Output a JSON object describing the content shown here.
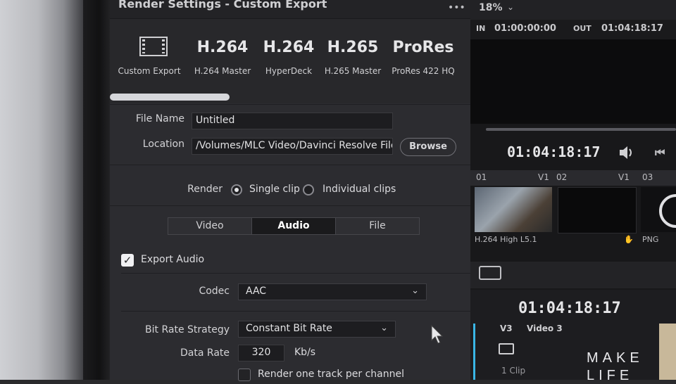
{
  "window": {
    "title": "Render Settings - Custom Export",
    "menu_glyph": "•••"
  },
  "presets": [
    {
      "big": "",
      "caption": "Custom Export",
      "icon": "film-icon"
    },
    {
      "big": "H.264",
      "caption": "H.264 Master"
    },
    {
      "big": "H.264",
      "caption": "HyperDeck"
    },
    {
      "big": "H.265",
      "caption": "H.265 Master"
    },
    {
      "big": "ProRes",
      "caption": "ProRes 422 HQ"
    }
  ],
  "file": {
    "name_label": "File Name",
    "name_value": "Untitled",
    "location_label": "Location",
    "location_value": "/Volumes/MLC Video/Davinci Resolve Files",
    "browse_label": "Browse"
  },
  "render": {
    "label": "Render",
    "single": "Single clip",
    "individual": "Individual clips",
    "selected": "single"
  },
  "tabs": [
    "Video",
    "Audio",
    "File"
  ],
  "active_tab": "Audio",
  "audio": {
    "export_label": "Export Audio",
    "export_checked": true,
    "codec_label": "Codec",
    "codec_value": "AAC",
    "bitrate_strategy_label": "Bit Rate Strategy",
    "bitrate_strategy_value": "Constant Bit Rate",
    "data_rate_label": "Data Rate",
    "data_rate_value": "320",
    "data_rate_unit": "Kb/s",
    "per_channel_label": "Render one track per channel",
    "per_channel_checked": false
  },
  "viewer": {
    "zoom": "18%",
    "in_label": "IN",
    "in_tc": "01:00:00:00",
    "out_label": "OUT",
    "out_tc": "01:04:18:17",
    "timecode": "01:04:18:17",
    "clip_num_1": "01",
    "track_v1": "V1",
    "clip_num_2": "02",
    "track_v1b": "V1",
    "clip_num_3": "03",
    "clip_caption": "H.264 High L5.1",
    "clip_caption_2": "PNG"
  },
  "timeline": {
    "timecode": "01:04:18:17",
    "track": "V3",
    "track_name": "Video 3",
    "clip_count": "1 Clip"
  },
  "watermark": {
    "line1": "MAKE",
    "line2": "LIFE"
  },
  "colors": {
    "accent": "#3ab6e6",
    "panel": "#2c2c30",
    "field": "#1d1d20"
  }
}
